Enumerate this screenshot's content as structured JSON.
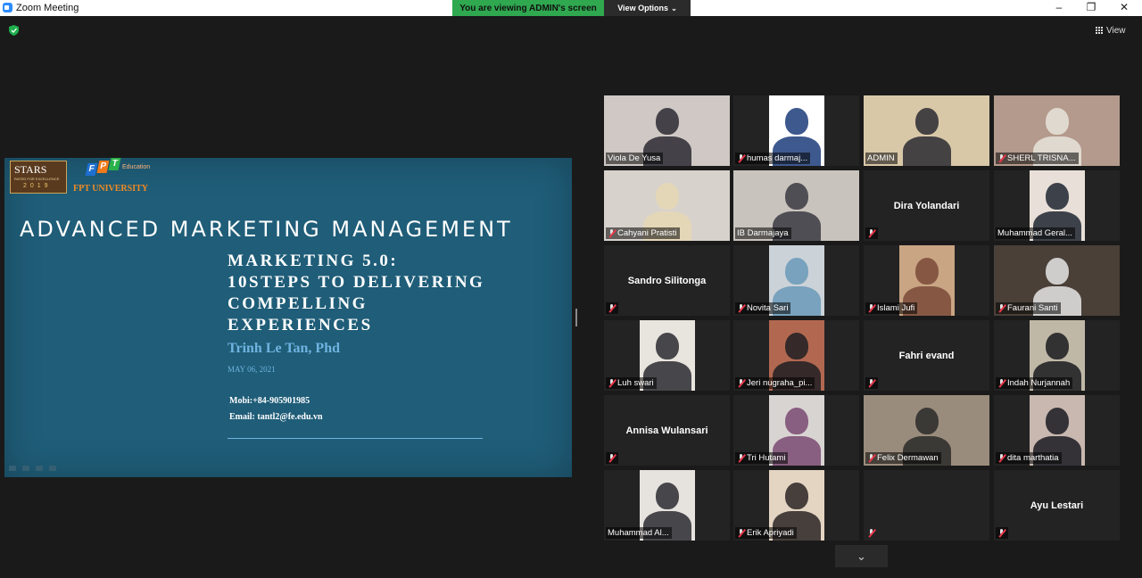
{
  "window": {
    "title": "Zoom Meeting",
    "viewing_banner": "You are viewing ADMIN's screen",
    "view_options": "View Options",
    "view_button": "View"
  },
  "slide": {
    "logo_stars": "STARS",
    "logo_stars_tag": "RATED FOR EXCELLENCE",
    "logo_stars_year": "2019",
    "fpt_letters": [
      "F",
      "P",
      "T"
    ],
    "fpt_education": "Education",
    "fpt_university": "FPT UNIVERSITY",
    "title": "ADVANCED MARKETING MANAGEMENT",
    "subtitle_lines": [
      "MARKETING 5.0:",
      "10STEPS TO DELIVERING",
      "COMPELLING",
      "EXPERIENCES"
    ],
    "author": "Trinh Le Tan, Phd",
    "date": "MAY 06, 2021",
    "mobile": "Mobi:+84-905901985",
    "email": "Email: tantl2@fe.edu.vn"
  },
  "participants": [
    {
      "name": "Viola De Yusa",
      "muted": false,
      "video": true,
      "bg": "#cfc8c4",
      "fg": "#2c2a33"
    },
    {
      "name": "humas darmaj...",
      "muted": true,
      "video": true,
      "bg": "#ffffff",
      "fg": "#1c3c7a"
    },
    {
      "name": "ADMIN",
      "muted": false,
      "video": true,
      "bg": "#d9c8a8",
      "fg": "#2a2a33",
      "active": true
    },
    {
      "name": "SHERL  TRISNA...",
      "muted": true,
      "video": true,
      "bg": "#b49a8c",
      "fg": "#e8e4dc"
    },
    {
      "name": "Cahyani Pratisti",
      "muted": true,
      "video": true,
      "bg": "#d8d2cc",
      "fg": "#e6d8b4"
    },
    {
      "name": "IB Darmajaya",
      "muted": false,
      "video": true,
      "bg": "#c9c3bd",
      "fg": "#3a3a42"
    },
    {
      "name": "Dira Yolandari",
      "muted": true,
      "video": false
    },
    {
      "name": "Muhammad Geral...",
      "muted": false,
      "video": true,
      "bg": "#e8e0d8",
      "fg": "#1e2430"
    },
    {
      "name": "Sandro Silitonga",
      "muted": true,
      "video": false
    },
    {
      "name": "Novita Sari",
      "muted": true,
      "video": true,
      "bg": "#cbd2d8",
      "fg": "#6a9ab8"
    },
    {
      "name": "Islami Jufi",
      "muted": true,
      "video": true,
      "bg": "#c9a583",
      "fg": "#7a4a3a"
    },
    {
      "name": "Faurani Santi",
      "muted": true,
      "video": true,
      "bg": "#4a4038",
      "fg": "#e6e6e6"
    },
    {
      "name": "Luh swari",
      "muted": true,
      "video": true,
      "bg": "#e8e4de",
      "fg": "#2a2a30"
    },
    {
      "name": "Jeri nugraha_pi...",
      "muted": true,
      "video": true,
      "bg": "#b26850",
      "fg": "#1e1e22"
    },
    {
      "name": "Fahri evand",
      "muted": true,
      "video": false
    },
    {
      "name": "Indah Nurjannah",
      "muted": true,
      "video": true,
      "bg": "#c0b8a6",
      "fg": "#1a1a1e"
    },
    {
      "name": "Annisa Wulansari",
      "muted": true,
      "video": false
    },
    {
      "name": "Tri Hutami",
      "muted": true,
      "video": true,
      "bg": "#d8d4d2",
      "fg": "#7a4a72"
    },
    {
      "name": "Felix Dermawan",
      "muted": true,
      "video": true,
      "bg": "#9a8c7c",
      "fg": "#2a2a2a"
    },
    {
      "name": "dita marthatia",
      "muted": true,
      "video": true,
      "bg": "#c8b8b0",
      "fg": "#1a1a22"
    },
    {
      "name": "Muhammad Al...",
      "muted": false,
      "video": true,
      "bg": "#e6e2de",
      "fg": "#2a2a30"
    },
    {
      "name": "Erik Apriyadi",
      "muted": true,
      "video": true,
      "bg": "#e4d4c2",
      "fg": "#2a2424"
    },
    {
      "name": "",
      "muted": true,
      "video": false
    },
    {
      "name": "Ayu Lestari",
      "muted": true,
      "video": false
    }
  ]
}
